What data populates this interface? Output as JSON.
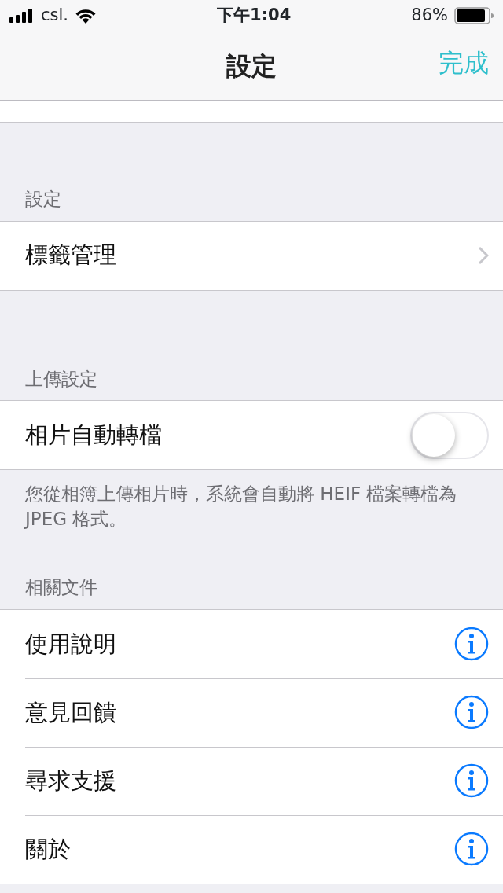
{
  "status_bar": {
    "carrier": "csl.",
    "time": "下午1:04",
    "battery_text": "86%"
  },
  "nav_bar": {
    "title": "設定",
    "done_button": "完成"
  },
  "sections": [
    {
      "header": "設定",
      "rows": [
        {
          "kind": "link",
          "label": "標籤管理"
        }
      ]
    },
    {
      "header": "上傳設定",
      "rows": [
        {
          "kind": "toggle",
          "label": "相片自動轉檔",
          "on": false
        }
      ],
      "footer": "您從相簿上傳相片時，系統會自動將 HEIF 檔案轉檔為 JPEG 格式。"
    },
    {
      "header": "相關文件",
      "rows": [
        {
          "kind": "info",
          "label": "使用說明"
        },
        {
          "kind": "info",
          "label": "意見回饋"
        },
        {
          "kind": "info",
          "label": "尋求支援"
        },
        {
          "kind": "info",
          "label": "關於"
        }
      ]
    }
  ]
}
